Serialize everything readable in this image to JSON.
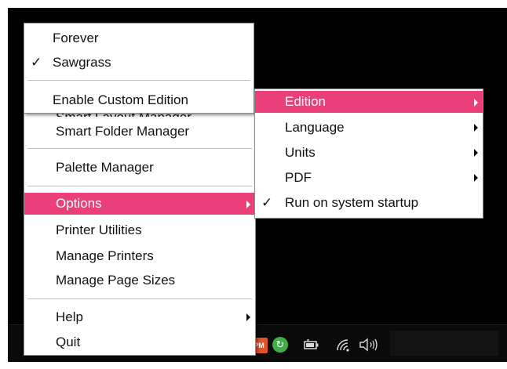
{
  "main_menu": {
    "partial_item": "Smart Layout Manager",
    "items": [
      {
        "label": "Smart Folder Manager"
      },
      {
        "label": "Palette Manager"
      },
      {
        "label": "Options"
      },
      {
        "label": "Printer Utilities"
      },
      {
        "label": "Manage Printers"
      },
      {
        "label": "Manage Page Sizes"
      },
      {
        "label": "Help"
      },
      {
        "label": "Quit"
      }
    ]
  },
  "edition_menu": {
    "items": [
      {
        "label": "Forever",
        "checked": false
      },
      {
        "label": "Sawgrass",
        "checked": true
      },
      {
        "label": "Enable Custom Edition"
      }
    ]
  },
  "options_menu": {
    "items": [
      {
        "label": "Edition"
      },
      {
        "label": "Language"
      },
      {
        "label": "Units"
      },
      {
        "label": "PDF"
      },
      {
        "label": "Run on system startup",
        "checked": true
      }
    ]
  },
  "glyphs": {
    "check": "✓",
    "sync": "↻",
    "volume": "🔈",
    "volume_waves": ")))",
    "wifi": "◔",
    "battery": "▭",
    "pm": "PM"
  },
  "colors": {
    "highlight": "#ea3f7b",
    "desktop": "#000000",
    "menu_bg": "#ffffff"
  }
}
